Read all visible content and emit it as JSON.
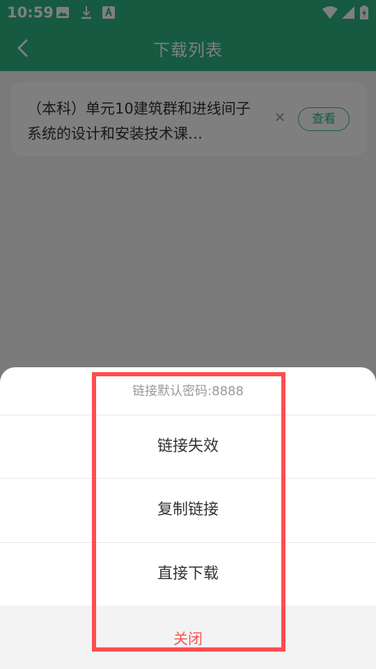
{
  "status_bar": {
    "time": "10:59",
    "icons": [
      "image-icon",
      "download-icon",
      "font-icon",
      "wifi-icon",
      "signal-icon",
      "battery-icon"
    ]
  },
  "app_bar": {
    "title": "下载列表"
  },
  "download_list": [
    {
      "name": "（本科）单元10建筑群和进线间子系统的设计和安装技术课…",
      "view_label": "查看"
    }
  ],
  "sheet": {
    "hint": "链接默认密码:8888",
    "options": [
      "链接失效",
      "复制链接",
      "直接下载"
    ],
    "close_label": "关闭"
  },
  "colors": {
    "primary": "#2db585",
    "close": "#f45555",
    "highlight": "#ff4d4f"
  }
}
